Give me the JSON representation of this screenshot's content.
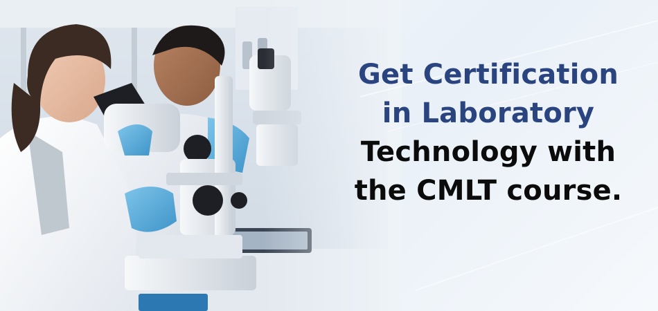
{
  "headline": {
    "line1": "Get Certification",
    "line2": "in Laboratory",
    "line3": "Technology with",
    "line4": "the CMLT course."
  },
  "colors": {
    "accent": "#2a4480",
    "text": "#0b0b0b",
    "background": "#eef3f8"
  },
  "photo": {
    "subject": "lab-technicians-microscopes-photo"
  }
}
